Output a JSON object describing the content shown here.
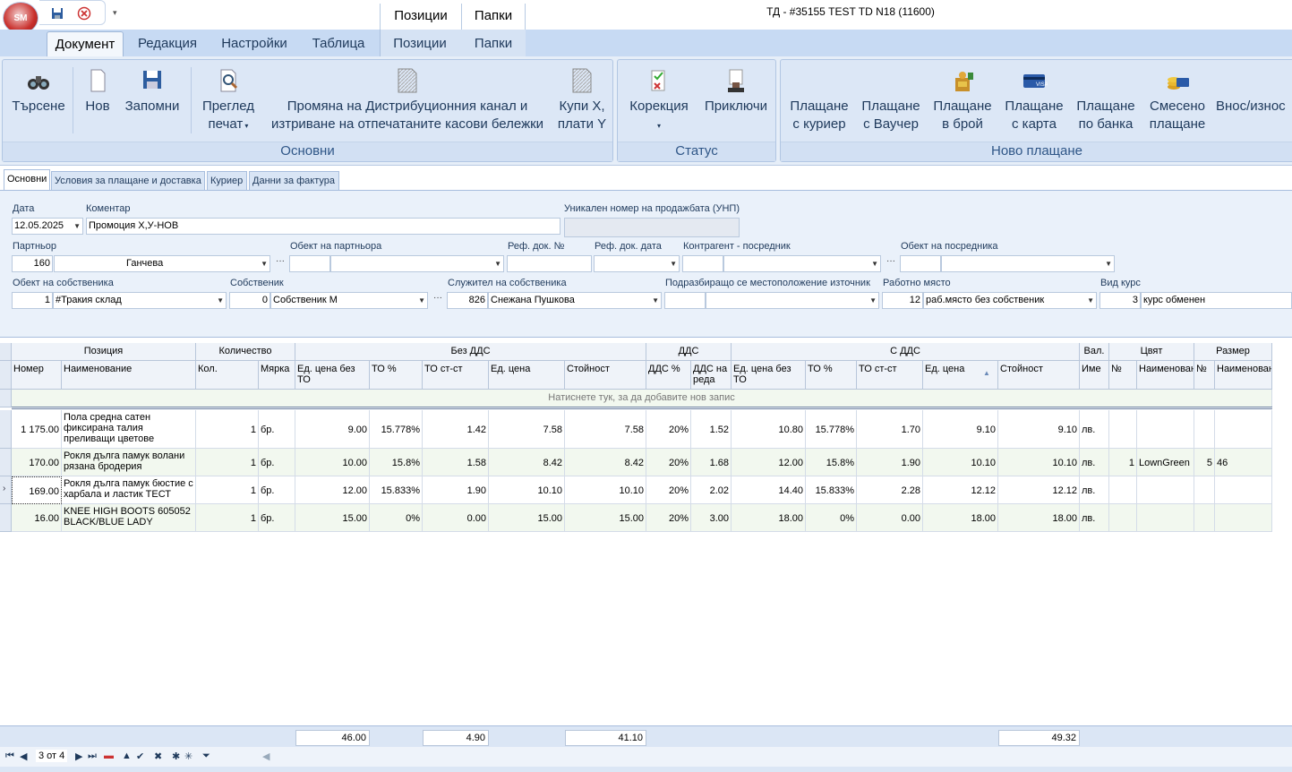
{
  "window": {
    "title": "ТД - #35155 TEST TD N18 (11600)",
    "app_logo": "SM"
  },
  "context_tabs": [
    "Позиции",
    "Папки"
  ],
  "tabs": [
    "Документ",
    "Редакция",
    "Настройки",
    "Таблица",
    "Позиции",
    "Папки"
  ],
  "ribbon": {
    "groups": {
      "osnovni": "Основни",
      "status": "Статус",
      "novo_plashtane": "Ново плащане"
    },
    "search": "Търсене",
    "new": "Нов",
    "save": "Запомни",
    "preview": [
      "Преглед",
      "печат"
    ],
    "change_channel": [
      "Промяна на Дистрибуционния канал и",
      "изтриване на отпечатаните касови бележки"
    ],
    "buy_x": [
      "Купи Х,",
      "плати Y"
    ],
    "correction": "Корекция",
    "finish": "Приключи",
    "pay_courier": [
      "Плащане",
      "с куриер"
    ],
    "pay_voucher": [
      "Плащане",
      "с Ваучер"
    ],
    "pay_cash": [
      "Плащане",
      "в брой"
    ],
    "pay_card": [
      "Плащане",
      "с карта"
    ],
    "pay_bank": [
      "Плащане",
      "по банка"
    ],
    "pay_mixed": [
      "Смесено",
      "плащане"
    ],
    "cash_inout": "Внос/износ"
  },
  "subtabs": [
    "Основни",
    "Условия за плащане и доставка",
    "Куриер",
    "Данни за фактура"
  ],
  "form": {
    "date_label": "Дата",
    "date": "12.05.2025",
    "comment_label": "Коментар",
    "comment": "Промоция Х,У-НОВ",
    "unp_label": "Уникален номер на продажбата (УНП)",
    "partner_label": "Партньор",
    "partner_code": "160",
    "partner_name": "Ганчева",
    "partner_obj_label": "Обект на партньора",
    "refdoc_label": "Реф. док. №",
    "refdate_label": "Реф. док. дата",
    "intermediary_label": "Контрагент - посредник",
    "intermediary_obj_label": "Обект на посредника",
    "owner_obj_label": "Обект на собственика",
    "owner_obj_code": "1",
    "owner_obj_name": "#Тракия склад",
    "owner_label": "Собственик",
    "owner_code": "0",
    "owner_name": "Собственик М",
    "employee_label": "Служител на собственика",
    "employee_code": "826",
    "employee_name": "Снежана Пушкова",
    "source_label": "Подразбиращо се местоположение източник",
    "workplace_label": "Работно място",
    "workplace_code": "12",
    "workplace_name": "раб.място без собственик",
    "rate_label": "Вид курс",
    "rate_code": "3",
    "rate_name": "курс обменен"
  },
  "grid": {
    "bands": {
      "pos": "Позиция",
      "qty": "Количество",
      "nodds": "Без ДДС",
      "dds": "ДДС",
      "withdds": "С ДДС",
      "val": "Вал.",
      "color": "Цвят",
      "size": "Размер"
    },
    "cols": {
      "num": "Номер",
      "name": "Наименование",
      "kol": "Кол.",
      "unit": "Мярка",
      "price_nodisc": "Ед. цена без ТО",
      "to1": "ТО %",
      "tocost1": "ТО ст-ст",
      "unitprice1": "Ед. цена",
      "value1": "Стойност",
      "dds_pct": "ДДС %",
      "dds_unit": "ДДС на реда",
      "price_nodisc2": "Ед. цена без ТО",
      "to2": "ТО %",
      "tocost2": "ТО ст-ст",
      "unitprice2": "Ед. цена",
      "value2": "Стойност",
      "cur": "Име",
      "cnum": "№",
      "cname": "Наименование",
      "snum": "№",
      "sname": "Наименование"
    },
    "new_row_hint": "Натиснете тук, за да добавите нов запис",
    "rows": [
      {
        "num": "1 175.00",
        "name": "Пола средна сатен фиксирана талия преливащи цветове",
        "kol": "1",
        "unit": "бр.",
        "p1": "9.00",
        "to1": "15.778%",
        "tc1": "1.42",
        "up1": "7.58",
        "v1": "7.58",
        "dp": "20%",
        "du": "1.52",
        "p2": "10.80",
        "to2": "15.778%",
        "tc2": "1.70",
        "up2": "9.10",
        "v2": "9.10",
        "cur": "лв.",
        "cnum": "",
        "cname": "",
        "snum": "",
        "sname": ""
      },
      {
        "num": "170.00",
        "name": "Рокля дълга памук волани рязана бродерия",
        "kol": "1",
        "unit": "бр.",
        "p1": "10.00",
        "to1": "15.8%",
        "tc1": "1.58",
        "up1": "8.42",
        "v1": "8.42",
        "dp": "20%",
        "du": "1.68",
        "p2": "12.00",
        "to2": "15.8%",
        "tc2": "1.90",
        "up2": "10.10",
        "v2": "10.10",
        "cur": "лв.",
        "cnum": "1",
        "cname": "LownGreen",
        "snum": "5",
        "sname": "46"
      },
      {
        "num": "169.00",
        "name": "Рокля дълга памук бюстие с харбала и ластик ТЕСТ",
        "kol": "1",
        "unit": "бр.",
        "p1": "12.00",
        "to1": "15.833%",
        "tc1": "1.90",
        "up1": "10.10",
        "v1": "10.10",
        "dp": "20%",
        "du": "2.02",
        "p2": "14.40",
        "to2": "15.833%",
        "tc2": "2.28",
        "up2": "12.12",
        "v2": "12.12",
        "cur": "лв.",
        "cnum": "",
        "cname": "",
        "snum": "",
        "sname": ""
      },
      {
        "num": "16.00",
        "name": "KNEE HIGH BOOTS 605052 BLACK/BLUE LADY",
        "kol": "1",
        "unit": "бр.",
        "p1": "15.00",
        "to1": "0%",
        "tc1": "0.00",
        "up1": "15.00",
        "v1": "15.00",
        "dp": "20%",
        "du": "3.00",
        "p2": "18.00",
        "to2": "0%",
        "tc2": "0.00",
        "up2": "18.00",
        "v2": "18.00",
        "cur": "лв.",
        "cnum": "",
        "cname": "",
        "snum": "",
        "sname": ""
      }
    ],
    "totals": {
      "p1": "46.00",
      "tc1": "4.90",
      "v1": "41.10",
      "v2": "49.32"
    }
  },
  "navigator": {
    "record": "3 от 4"
  }
}
